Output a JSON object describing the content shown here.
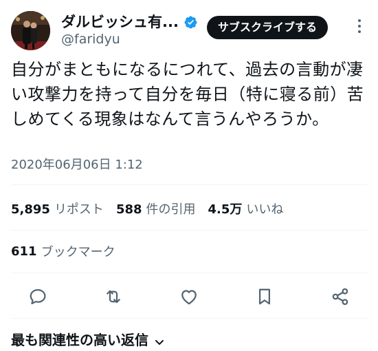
{
  "user": {
    "display_name": "ダルビッシュ有...",
    "handle": "@faridyu",
    "avatar_icon": "avatar-photo",
    "verified_icon": "verified-badge-icon"
  },
  "header": {
    "subscribe_label": "サブスクライブする",
    "more_icon": "more-vertical-icon"
  },
  "tweet": {
    "text": "自分がまともになるにつれて、過去の言動が凄い攻撃力を持って自分を毎日（特に寝る前）苦しめてくる現象はなんて言うんやろうか。",
    "timestamp": "2020年06月06日 1:12"
  },
  "stats": {
    "reposts": {
      "count": "5,895",
      "label": "リポスト"
    },
    "quotes": {
      "count": "588",
      "label": "件の引用"
    },
    "likes": {
      "count": "4.5万",
      "label": "いいね"
    },
    "bookmarks": {
      "count": "611",
      "label": "ブックマーク"
    }
  },
  "actions": [
    "reply-icon",
    "repost-icon",
    "like-icon",
    "bookmark-icon",
    "share-icon"
  ],
  "replies": {
    "sort_label": "最も関連性の高い返信"
  },
  "colors": {
    "text_primary": "#0f1419",
    "text_secondary": "#536471",
    "verified_blue": "#1d9bf0",
    "divider": "#eff3f4",
    "button_bg": "#0f1419"
  }
}
